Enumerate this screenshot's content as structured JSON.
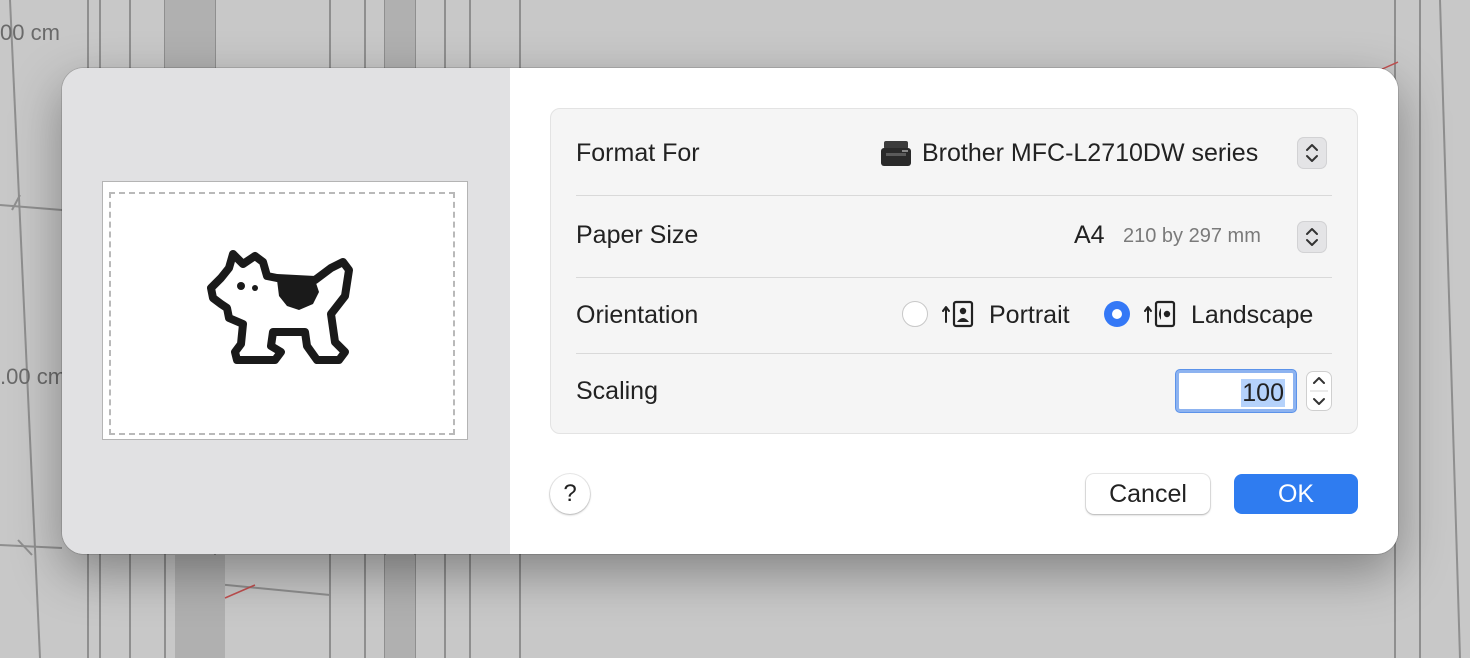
{
  "background": {
    "labels": [
      "00 cm",
      ".00 cm"
    ]
  },
  "dialog": {
    "preview": {
      "icon": "dogcow-icon",
      "orientation": "landscape"
    },
    "rows": {
      "format_for": {
        "label": "Format For",
        "printer_icon": "printer-icon",
        "value": "Brother MFC-L2710DW series"
      },
      "paper_size": {
        "label": "Paper Size",
        "value": "A4",
        "dimensions": "210 by 297 mm"
      },
      "orientation": {
        "label": "Orientation",
        "options": [
          {
            "label": "Portrait",
            "icon": "portrait-orientation-icon",
            "selected": false
          },
          {
            "label": "Landscape",
            "icon": "landscape-orientation-icon",
            "selected": true
          }
        ]
      },
      "scaling": {
        "label": "Scaling",
        "value": "100"
      }
    },
    "buttons": {
      "help": "?",
      "cancel": "Cancel",
      "ok": "OK"
    },
    "colors": {
      "accent": "#2f7cf0",
      "selection": "#b5d2fb"
    }
  }
}
